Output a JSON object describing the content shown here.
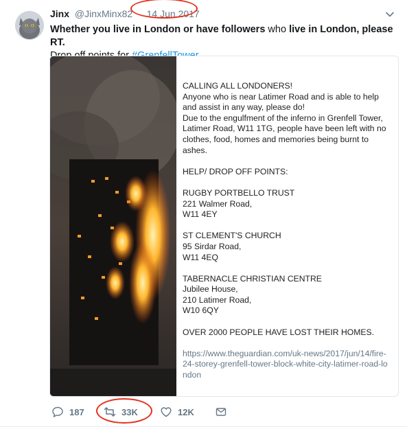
{
  "tweet": {
    "display_name": "Jinx",
    "handle": "@JinxMinx82",
    "separator": "·",
    "date": "14 Jun 2017",
    "text_parts": {
      "p1": "Whether you live in London or have followers",
      "p2": " who ",
      "p3": "live in London, please RT.",
      "p4": "Drop off points for ",
      "hashtag": "#GrenfellTower"
    }
  },
  "notice": {
    "heading": "CALLING ALL LONDONERS!",
    "line1": "Anyone who is near Latimer Road and is able to help and assist in any way, please do!",
    "line2": "Due to the engulfment of the inferno in Grenfell Tower, Latimer Road, W11 1TG, people have been left with no clothes, food, homes and memories being burnt to ashes.",
    "help_heading": "HELP/ DROP OFF POINTS:",
    "point1": [
      "RUGBY PORTBELLO TRUST",
      "221 Walmer Road,",
      "W11 4EY"
    ],
    "point2": [
      "ST CLEMENT'S CHURCH",
      "95 Sirdar Road,",
      "W11 4EQ"
    ],
    "point3": [
      "TABERNACLE CHRISTIAN CENTRE",
      "Jubilee House,",
      "210 Latimer Road,",
      "W10 6QY"
    ],
    "over": "OVER 2000 PEOPLE HAVE LOST THEIR HOMES.",
    "link": "https://www.theguardian.com/uk-news/2017/jun/14/fire-24-storey-grenfell-tower-block-white-city-latimer-road-london"
  },
  "actions": {
    "reply_count": "187",
    "retweet_count": "33K",
    "like_count": "12K"
  },
  "colors": {
    "accent": "#1b95e0",
    "annotation": "#e5301c",
    "muted": "#657786"
  }
}
